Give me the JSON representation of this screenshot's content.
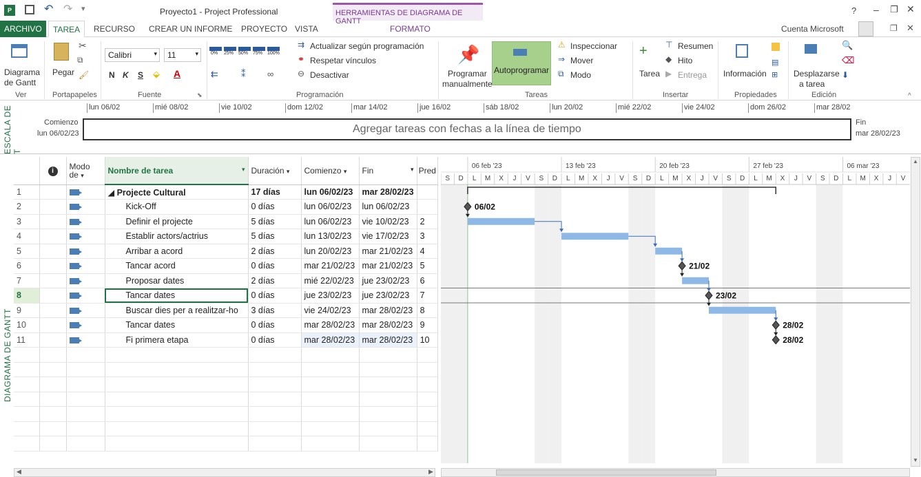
{
  "window": {
    "title": "Proyecto1 - Project Professional",
    "context_tool": "HERRAMIENTAS DE DIAGRAMA DE GANTT",
    "help": "?",
    "account": "Cuenta Microsoft"
  },
  "tabs": [
    {
      "label": "ARCHIVO"
    },
    {
      "label": "TAREA"
    },
    {
      "label": "RECURSO"
    },
    {
      "label": "CREAR UN INFORME"
    },
    {
      "label": "PROYECTO"
    },
    {
      "label": "VISTA"
    },
    {
      "label": "FORMATO"
    }
  ],
  "ribbon": {
    "view_btn": "Diagrama",
    "view_btn2": "de Gantt",
    "paste": "Pegar",
    "font_name": "Calibri",
    "font_size": "11",
    "bold": "N",
    "italic": "K",
    "underline": "S",
    "pct": [
      "0%",
      "25%",
      "50%",
      "75%",
      "100%"
    ],
    "update_schedule": "Actualizar según programación",
    "respect_links": "Respetar vínculos",
    "deactivate": "Desactivar",
    "manual1": "Programar",
    "manual2": "manualmente",
    "auto": "Autoprogramar",
    "inspect": "Inspeccionar",
    "move": "Mover",
    "mode": "Modo",
    "task": "Tarea",
    "summary": "Resumen",
    "milestone": "Hito",
    "deliverable": "Entrega",
    "information": "Información",
    "scroll1": "Desplazarse",
    "scroll2": "a tarea",
    "groups": [
      "Ver",
      "Portapapeles",
      "Fuente",
      "Programación",
      "Tareas",
      "Insertar",
      "Propiedades",
      "Edición"
    ]
  },
  "timeline": {
    "side_label": "ESCALA DE T",
    "start_label": "Comienzo",
    "start_date": "lun 06/02/23",
    "end_label": "Fin",
    "end_date": "mar 28/02/23",
    "placeholder": "Agregar tareas con fechas a la línea de tiempo",
    "ticks": [
      "lun 06/02",
      "mié 08/02",
      "vie 10/02",
      "dom 12/02",
      "mar 14/02",
      "jue 16/02",
      "sáb 18/02",
      "lun 20/02",
      "mié 22/02",
      "vie 24/02",
      "dom 26/02",
      "mar 28/02"
    ]
  },
  "sheet": {
    "side_label": "DIAGRAMA DE GANTT",
    "columns": {
      "mode1": "Modo",
      "mode2": "de",
      "name": "Nombre de tarea",
      "duration": "Duración",
      "start": "Comienzo",
      "finish": "Fin",
      "pred": "Pred"
    },
    "rows": [
      {
        "id": "1",
        "name": "◢ Projecte Cultural",
        "duration": "17 días",
        "start": "lun 06/02/23",
        "finish": "mar 28/02/23",
        "pred": ""
      },
      {
        "id": "2",
        "name": "Kick-Off",
        "duration": "0 días",
        "start": "lun 06/02/23",
        "finish": "lun 06/02/23",
        "pred": ""
      },
      {
        "id": "3",
        "name": "Definir el projecte",
        "duration": "5 días",
        "start": "lun 06/02/23",
        "finish": "vie 10/02/23",
        "pred": "2"
      },
      {
        "id": "4",
        "name": "Establir actors/actrius",
        "duration": "5 días",
        "start": "lun 13/02/23",
        "finish": "vie 17/02/23",
        "pred": "3"
      },
      {
        "id": "5",
        "name": "Arribar a acord",
        "duration": "2 días",
        "start": "lun 20/02/23",
        "finish": "mar 21/02/23",
        "pred": "4"
      },
      {
        "id": "6",
        "name": "Tancar acord",
        "duration": "0 días",
        "start": "mar 21/02/23",
        "finish": "mar 21/02/23",
        "pred": "5"
      },
      {
        "id": "7",
        "name": "Proposar dates",
        "duration": "2 días",
        "start": "mié 22/02/23",
        "finish": "jue 23/02/23",
        "pred": "6"
      },
      {
        "id": "8",
        "name": "Tancar dates",
        "duration": "0 días",
        "start": "jue 23/02/23",
        "finish": "jue 23/02/23",
        "pred": "7"
      },
      {
        "id": "9",
        "name": "Buscar dies per a realitzar-ho",
        "duration": "3 días",
        "start": "vie 24/02/23",
        "finish": "mar 28/02/23",
        "pred": "8"
      },
      {
        "id": "10",
        "name": "Tancar dates",
        "duration": "0 días",
        "start": "mar 28/02/23",
        "finish": "mar 28/02/23",
        "pred": "9"
      },
      {
        "id": "11",
        "name": "Fi primera etapa",
        "duration": "0 días",
        "start": "mar 28/02/23",
        "finish": "mar 28/02/23",
        "pred": "10"
      }
    ]
  },
  "gantt": {
    "weeks": [
      "06 feb '23",
      "13 feb '23",
      "20 feb '23",
      "27 feb '23",
      "06 mar '23"
    ],
    "days": [
      "S",
      "D",
      "L",
      "M",
      "X",
      "J",
      "V",
      "S",
      "D",
      "L",
      "M",
      "X",
      "J",
      "V",
      "S",
      "D",
      "L",
      "M",
      "X",
      "J",
      "V",
      "S",
      "D",
      "L",
      "M",
      "X",
      "J",
      "V",
      "S",
      "D",
      "L",
      "M",
      "X",
      "J",
      "V"
    ],
    "milestone_labels": [
      "06/02",
      "21/02",
      "23/02",
      "28/02",
      "28/02"
    ]
  }
}
